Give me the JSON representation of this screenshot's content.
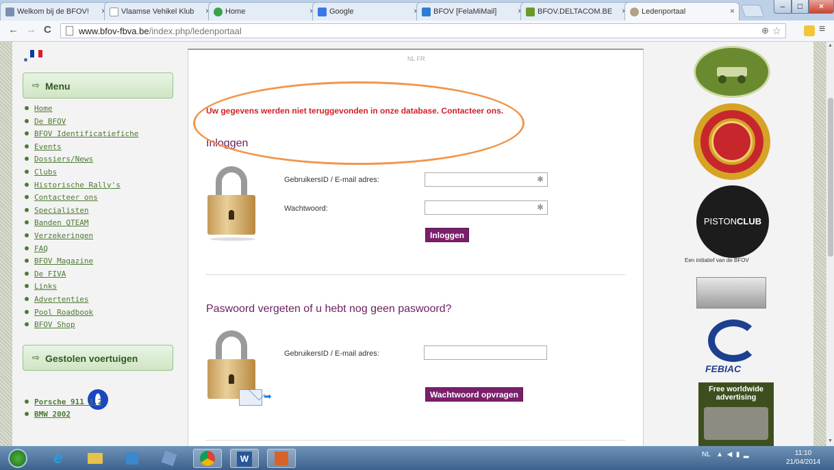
{
  "browser": {
    "tabs": [
      {
        "title": "Welkom bij de BFOV!",
        "favicon_color": "#7a8fb0"
      },
      {
        "title": "Vlaamse Vehikel Klub",
        "favicon_color": "#ffffff"
      },
      {
        "title": "Home",
        "favicon_color": "#3aa24a"
      },
      {
        "title": "Google",
        "favicon_color": "#3b78e7"
      },
      {
        "title": "BFOV [FelaMiMail]",
        "favicon_color": "#2a7fd4"
      },
      {
        "title": "BFOV.DELTACOM.BE",
        "favicon_color": "#6a9a2a"
      },
      {
        "title": "Ledenportaal",
        "favicon_color": "#b0a488"
      }
    ],
    "close_glyph": "×",
    "url_host": "www.bfov-fbva.be",
    "url_path": "/index.php/ledenportaal"
  },
  "sidebar": {
    "menu_title": "Menu",
    "nav_items": [
      "Home",
      "De BFOV",
      "BFOV Identificatiefiche",
      "Events",
      "Dossiers/News",
      "Clubs",
      "Historische Rally's",
      "Contacteer ons",
      "Specialisten",
      "Banden QTEAM",
      "Verzekeringen",
      "FAQ",
      "BFOV Magazine",
      "De FIVA",
      "Links",
      "Advertenties",
      "Pool Roadbook",
      "BFOV Shop"
    ],
    "stolen_title": "Gestolen voertuigen",
    "stolen_cars": [
      "Porsche 911 3.2",
      "BMW 2002"
    ]
  },
  "main": {
    "lang_switch": "NL FR",
    "error": "Uw gegevens werden niet teruggevonden in onze database. Contacteer ons.",
    "login": {
      "heading": "Inloggen",
      "user_label": "GebruikersID / E-mail adres:",
      "password_label": "Wachtwoord:",
      "required_marker": "✱",
      "submit": "Inloggen"
    },
    "forgot": {
      "heading": "Paswoord vergeten of u hebt nog geen paswoord?",
      "user_label": "GebruikersID / E-mail adres:",
      "submit": "Wachtwoord opvragen"
    }
  },
  "right": {
    "piston_text_a": "PISTON",
    "piston_text_b": "CLUB",
    "initiatief": "Een initiatief van de BFOV",
    "febiac": "FEBIAC",
    "ad_text": "Free worldwide advertising"
  },
  "taskbar": {
    "lang": "NL",
    "time": "11:10",
    "date": "21/04/2014"
  },
  "colors": {
    "accent_purple": "#7a1f6a",
    "error_red": "#d01f26",
    "annotation_orange": "#f2954b",
    "sidebar_green": "#4d7a33"
  }
}
